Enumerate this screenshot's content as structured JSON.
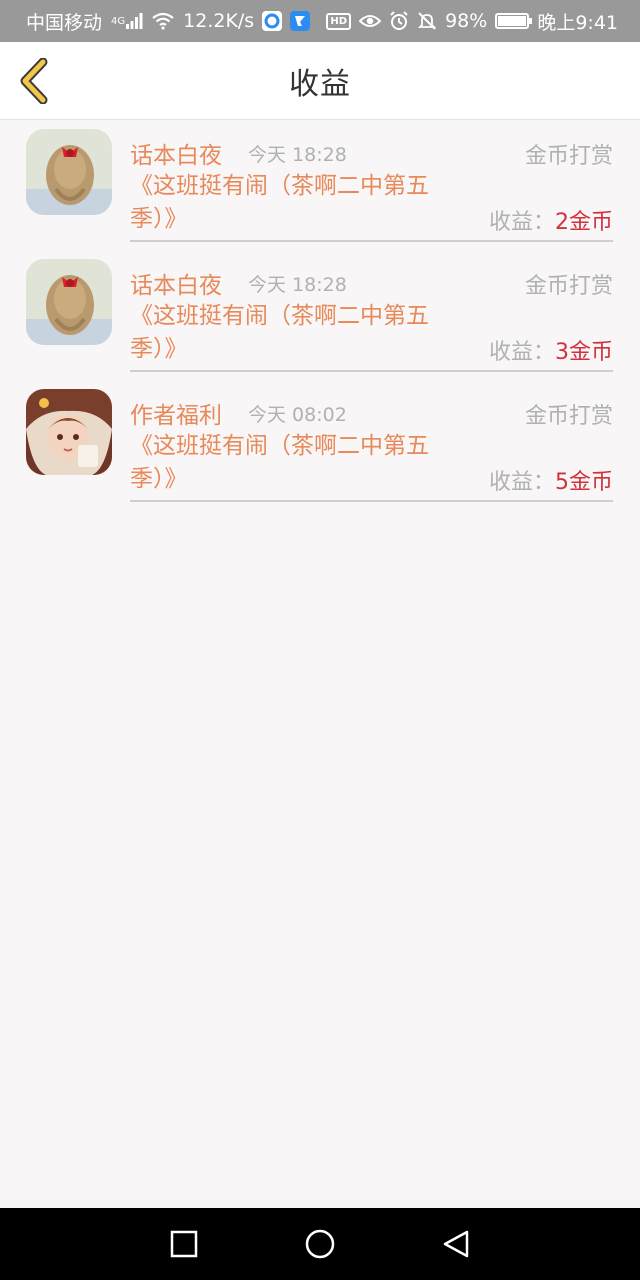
{
  "status_bar": {
    "carrier": "中国移动",
    "network": "4G",
    "speed": "12.2K/s",
    "battery": "98%",
    "time": "晚上9:41",
    "hd_label": "HD"
  },
  "header": {
    "title": "收益",
    "back_icon": "chevron-left-icon"
  },
  "items": [
    {
      "author": "话本白夜",
      "time": "今天 18:28",
      "type": "金币打赏",
      "book_title": "《这班挺有闹（茶啊二中第五季）》",
      "earnings_label": "收益：",
      "earnings_value": "2金币"
    },
    {
      "author": "话本白夜",
      "time": "今天 18:28",
      "type": "金币打赏",
      "book_title": "《这班挺有闹（茶啊二中第五季）》",
      "earnings_label": "收益：",
      "earnings_value": "3金币"
    },
    {
      "author": "作者福利",
      "time": "今天 08:02",
      "type": "金币打赏",
      "book_title": "《这班挺有闹（茶啊二中第五季）》",
      "earnings_label": "收益：",
      "earnings_value": "5金币"
    }
  ],
  "colors": {
    "accent_orange": "#e8895a",
    "earnings_red": "#d0323c",
    "muted_gray": "#b1b1b1",
    "back_icon": "#f3c64a"
  }
}
